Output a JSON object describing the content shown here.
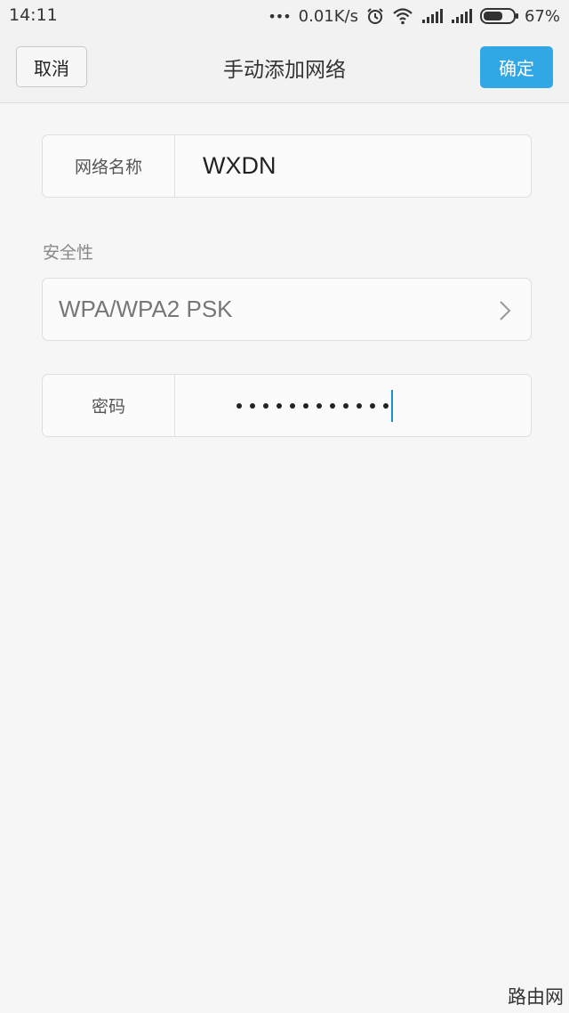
{
  "status_bar": {
    "time": "14:11",
    "dots": "•••",
    "net_speed": "0.01K/s",
    "battery_percent": "67%",
    "battery_level": 0.67,
    "icons": [
      "alarm-icon",
      "wifi-icon",
      "signal-icon",
      "signal-icon",
      "battery-icon"
    ]
  },
  "header": {
    "cancel_label": "取消",
    "title": "手动添加网络",
    "confirm_label": "确定",
    "accent_color": "#32a7e6"
  },
  "form": {
    "ssid": {
      "label": "网络名称",
      "value": "WXDN"
    },
    "security": {
      "section_label": "安全性",
      "value": "WPA/WPA2 PSK",
      "icon": "chevron-right-icon"
    },
    "password": {
      "label": "密码",
      "masked_length": 12
    }
  },
  "watermark": "路由网"
}
